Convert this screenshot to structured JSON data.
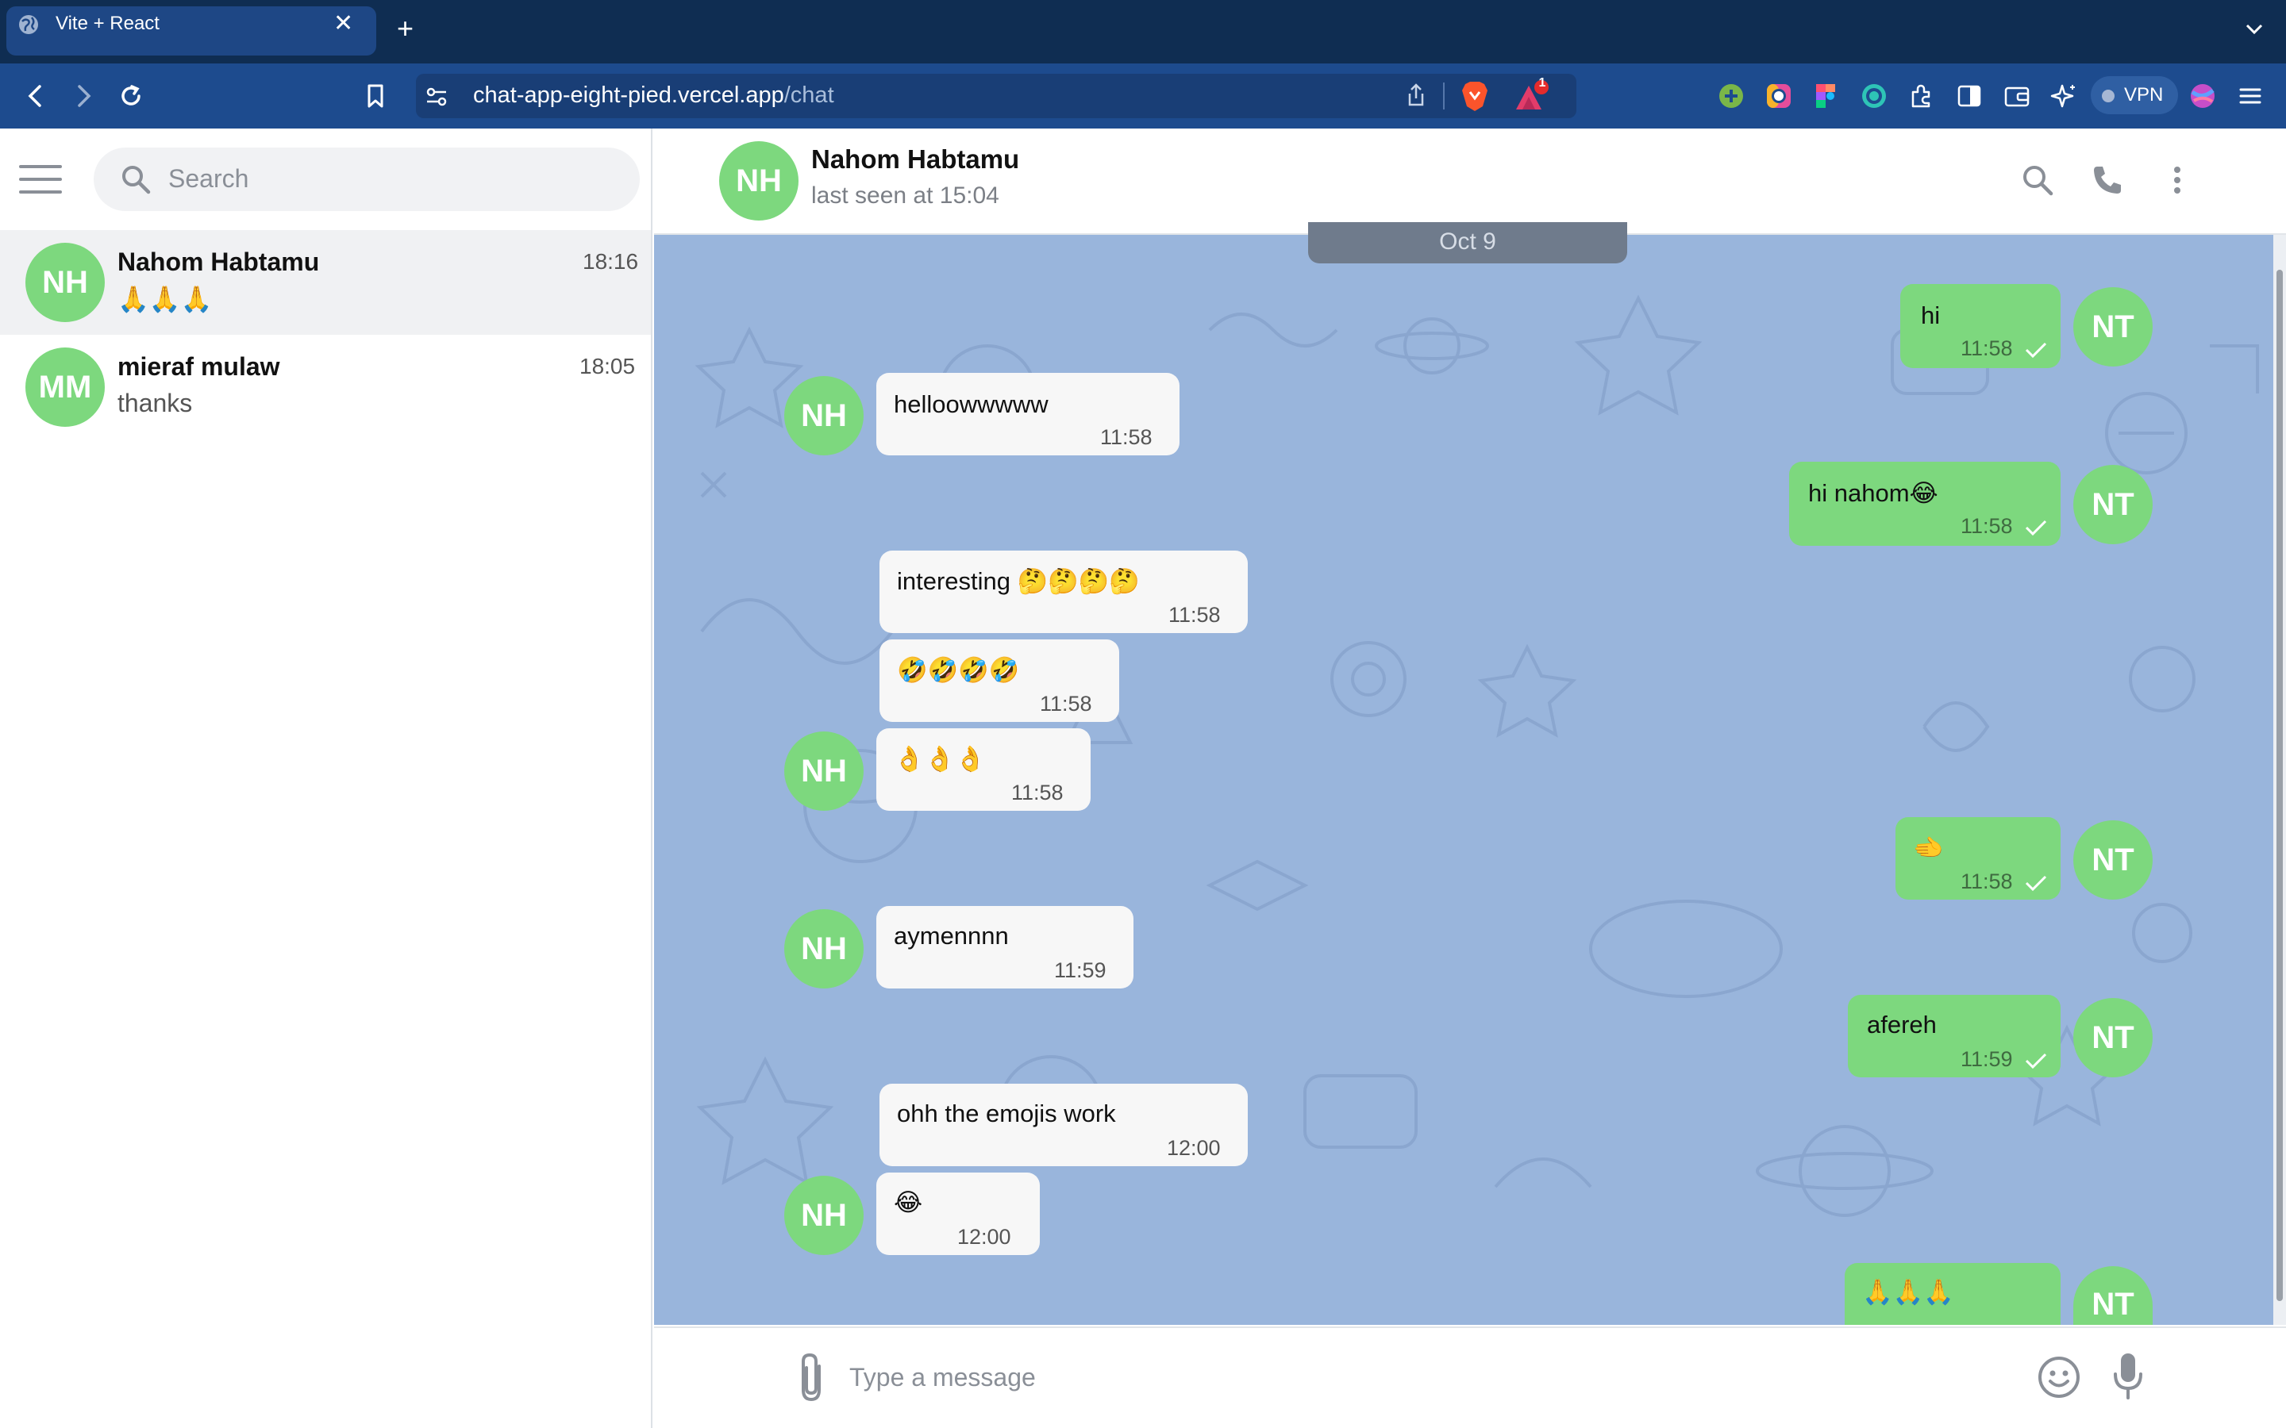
{
  "browser": {
    "tab_title": "Vite + React",
    "url_host": "chat-app-eight-pied.vercel.app",
    "url_path": "/chat",
    "alerts_badge": "1",
    "vpn_label": "VPN"
  },
  "sidebar": {
    "search_placeholder": "Search",
    "chats": [
      {
        "initials": "NH",
        "name": "Nahom Habtamu",
        "preview": "🙏🙏🙏",
        "time": "18:16",
        "active": true
      },
      {
        "initials": "MM",
        "name": "mieraf mulaw",
        "preview": "thanks",
        "time": "18:05",
        "active": false
      }
    ]
  },
  "header": {
    "initials": "NH",
    "name": "Nahom Habtamu",
    "status": "last seen at 15:04"
  },
  "date_divider": "Oct 9",
  "messages": [
    {
      "dir": "out",
      "text": "hi",
      "time": "11:58",
      "avatar": "NT"
    },
    {
      "dir": "in",
      "text": "helloowwwww",
      "time": "11:58",
      "avatar": "NH"
    },
    {
      "dir": "out",
      "text": "hi nahom😂",
      "time": "11:58",
      "avatar": "NT"
    },
    {
      "dir": "in",
      "text": "interesting 🤔🤔🤔🤔",
      "time": "11:58"
    },
    {
      "dir": "in",
      "text": "🤣🤣🤣🤣",
      "time": "11:58"
    },
    {
      "dir": "in",
      "text": "👌👌👌",
      "time": "11:58",
      "avatar": "NH"
    },
    {
      "dir": "out",
      "text": "🫲",
      "time": "11:58",
      "avatar": "NT"
    },
    {
      "dir": "in",
      "text": "aymennnn",
      "time": "11:59",
      "avatar": "NH"
    },
    {
      "dir": "out",
      "text": "afereh",
      "time": "11:59",
      "avatar": "NT"
    },
    {
      "dir": "in",
      "text": "ohh the emojis work",
      "time": "12:00"
    },
    {
      "dir": "in",
      "text": "😂",
      "time": "12:00",
      "avatar": "NH"
    },
    {
      "dir": "out",
      "text": "🙏🙏🙏",
      "time": "",
      "avatar": "NT"
    }
  ],
  "composer": {
    "placeholder": "Type a message"
  },
  "colors": {
    "chrome_dark": "#0f2d52",
    "chrome_toolbar": "#1d4b8e",
    "avatar_green": "#7dd87e",
    "chat_background": "#99b5dc",
    "incoming_bubble": "#f7f7f7",
    "outgoing_bubble": "#7dd87e"
  }
}
